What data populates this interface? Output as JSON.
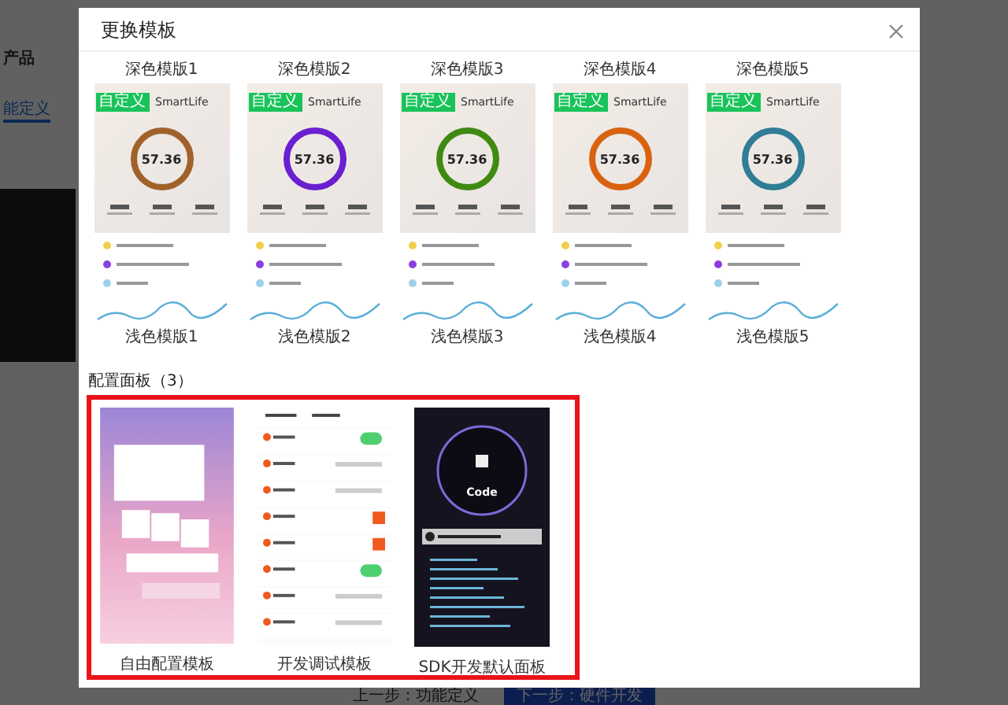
{
  "background": {
    "side_label": "产品",
    "tab_label": "能定义",
    "prev_button": "上一步：功能定义",
    "next_button": "下一步：硬件开发"
  },
  "dialog": {
    "title": "更换模板",
    "templates": [
      {
        "top_label": "深色模版1",
        "bottom_label": "浅色模版1",
        "badge": "自定义",
        "app_name": "SmartLife",
        "reading": "57.36",
        "color": "#a0622a"
      },
      {
        "top_label": "深色模版2",
        "bottom_label": "浅色模版2",
        "badge": "自定义",
        "app_name": "SmartLife",
        "reading": "57.36",
        "color": "#6a1fd0"
      },
      {
        "top_label": "深色模版3",
        "bottom_label": "浅色模版3",
        "badge": "自定义",
        "app_name": "SmartLife",
        "reading": "57.36",
        "color": "#3f8a12"
      },
      {
        "top_label": "深色模版4",
        "bottom_label": "浅色模版4",
        "badge": "自定义",
        "app_name": "SmartLife",
        "reading": "57.36",
        "color": "#d9620f"
      },
      {
        "top_label": "深色模版5",
        "bottom_label": "浅色模版5",
        "badge": "自定义",
        "app_name": "SmartLife",
        "reading": "57.36",
        "color": "#2f7d96"
      }
    ],
    "config_section": {
      "title": "配置面板（3）",
      "highlighted": true,
      "panels": [
        {
          "kind": "gradient",
          "label": "自由配置模板"
        },
        {
          "kind": "debug",
          "label": "开发调试模板"
        },
        {
          "kind": "code",
          "label": "SDK开发默认面板",
          "caption": "Code"
        }
      ]
    }
  }
}
